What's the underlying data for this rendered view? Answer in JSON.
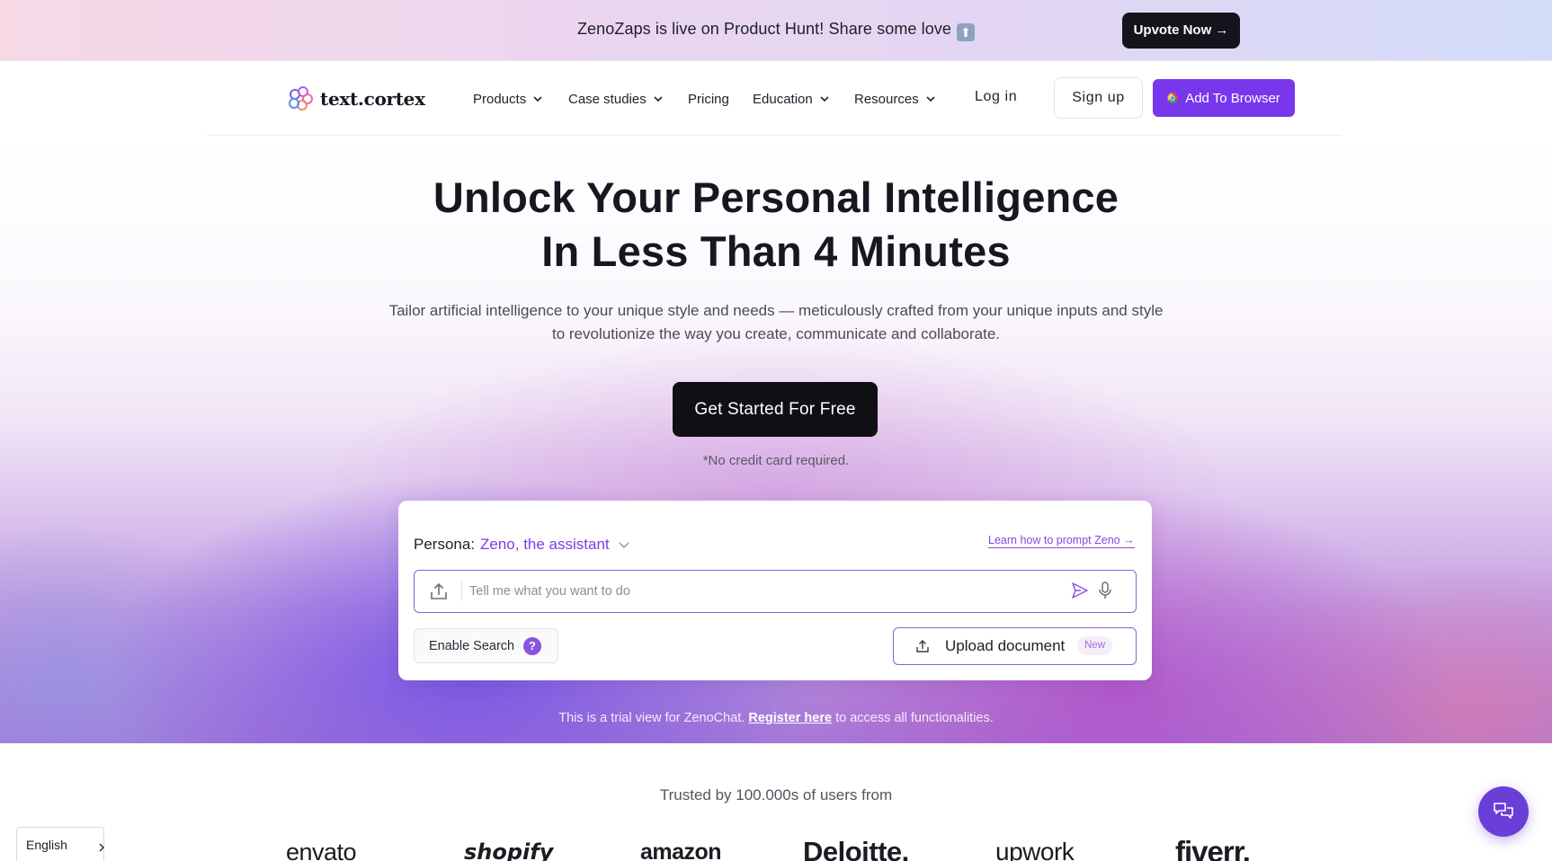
{
  "announcement": {
    "text": "ZenoZaps is live on Product Hunt! Share some love",
    "emoji": "⬆",
    "button_label": "Upvote Now →"
  },
  "nav": {
    "logo_text": "text.cortex",
    "logo_icon": "brain-icon",
    "items": [
      {
        "label": "Products",
        "has_dropdown": true
      },
      {
        "label": "Case studies",
        "has_dropdown": true
      },
      {
        "label": "Pricing",
        "has_dropdown": false
      },
      {
        "label": "Education",
        "has_dropdown": true
      },
      {
        "label": "Resources",
        "has_dropdown": true
      }
    ],
    "login_label": "Log in",
    "signup_label": "Sign up",
    "add_browser_label": "Add To Browser"
  },
  "hero": {
    "title_line1": "Unlock Your Personal Intelligence",
    "title_line2": "In Less Than 4 Minutes",
    "subtitle": "Tailor artificial intelligence to your unique style and needs — meticulously crafted from your unique inputs and style to revolutionize the way you create, communicate and collaborate.",
    "cta_label": "Get Started For Free",
    "cta_note": "*No credit card required."
  },
  "chat_card": {
    "persona_label": "Persona:",
    "persona_value": "Zeno, the assistant",
    "learn_link": "Learn how to prompt Zeno →",
    "input_placeholder": "Tell me what you want to do",
    "input_value": "",
    "enable_search_label": "Enable Search",
    "help_glyph": "?",
    "upload_label": "Upload document",
    "new_badge": "New"
  },
  "trial_note": {
    "prefix": "This is a trial view for ZenoChat.",
    "link": "Register here",
    "suffix": "to access all functionalities."
  },
  "trusted": {
    "heading": "Trusted by 100.000s of users from",
    "brands": [
      "envato",
      "shopify",
      "amazon",
      "Deloitte.",
      "upwork",
      "fiverr."
    ]
  },
  "language": {
    "selected": "English"
  },
  "colors": {
    "accent": "#7837ec",
    "dark_button": "#15141c",
    "persona": "#7a3de6",
    "chat_fab": "#6a3fd8"
  }
}
